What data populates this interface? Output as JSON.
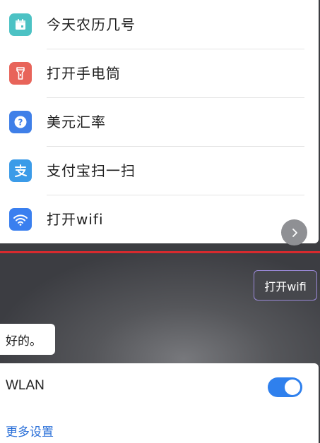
{
  "suggestions": [
    {
      "label": "今天农历几号",
      "icon": "calendar-icon",
      "color": "#4cc2c4"
    },
    {
      "label": "打开手电筒",
      "icon": "flashlight-icon",
      "color": "#e8645a"
    },
    {
      "label": "美元汇率",
      "icon": "question-icon",
      "color": "#3f7fe8"
    },
    {
      "label": "支付宝扫一扫",
      "icon": "alipay-icon",
      "color": "#3b9be8"
    },
    {
      "label": "打开wifi",
      "icon": "wifi-icon",
      "color": "#3a7fef"
    }
  ],
  "chat": {
    "user_message": "打开wifi",
    "assistant_reply": "好的。"
  },
  "wlan": {
    "title": "WLAN",
    "enabled": true,
    "more_settings": "更多设置"
  },
  "colors": {
    "accent": "#2f80ed",
    "divider_red": "#d72a2e"
  }
}
